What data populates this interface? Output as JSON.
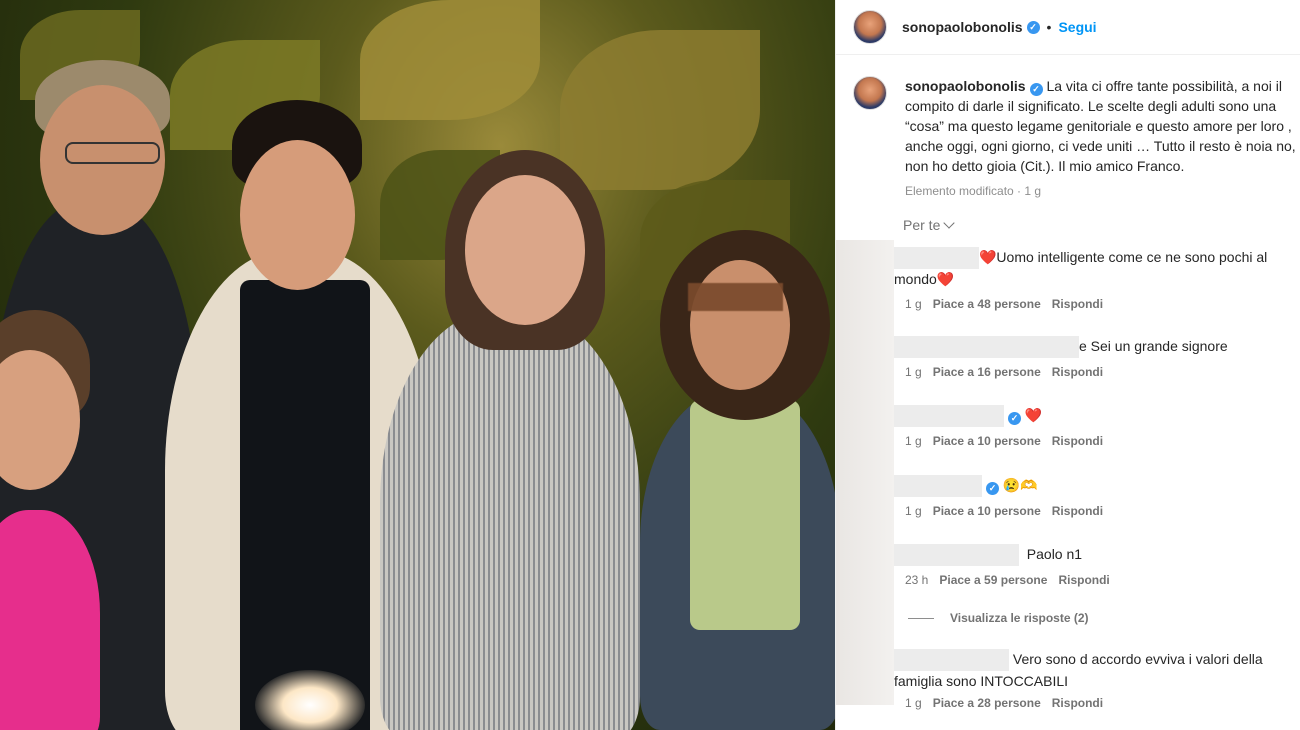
{
  "header": {
    "username": "sonopaolobonolis",
    "separator": "•",
    "follow_label": "Segui"
  },
  "caption": {
    "username": "sonopaolobonolis",
    "text": "La vita ci offre tante possibilità, a noi il compito di darle il significato. Le scelte degli adulti sono una “cosa” ma questo legame genitoriale e questo amore per loro , anche oggi, ogni giorno, ci vede uniti … Tutto il resto è noia no, non ho detto gioia (Cit.). Il mio amico Franco.",
    "meta": "Elemento modificato · 1 g"
  },
  "sort_label": "Per te",
  "comments": [
    {
      "text": "❤️Uomo intelligente come ce ne sono pochi al mondo❤️",
      "time": "1 g",
      "likes": "Piace a 48 persone",
      "reply": "Rispondi"
    },
    {
      "text": "e Sei un grande signore",
      "time": "1 g",
      "likes": "Piace a 16 persone",
      "reply": "Rispondi"
    },
    {
      "text": "❤️",
      "time": "1 g",
      "likes": "Piace a 10 persone",
      "reply": "Rispondi"
    },
    {
      "text": "😢🫶",
      "time": "1 g",
      "likes": "Piace a 10 persone",
      "reply": "Rispondi"
    },
    {
      "text": "Paolo n1",
      "time": "23 h",
      "likes": "Piace a 59 persone",
      "reply": "Rispondi"
    },
    {
      "text": "Vero sono d accordo evviva i valori della famiglia sono INTOCCABILI",
      "time": "1 g",
      "likes": "Piace a 28 persone",
      "reply": "Rispondi"
    }
  ],
  "view_replies": "Visualizza le risposte (2)",
  "colors": {
    "accent": "#0095f6",
    "verified": "#3897f0",
    "heart": "#e0245e"
  }
}
